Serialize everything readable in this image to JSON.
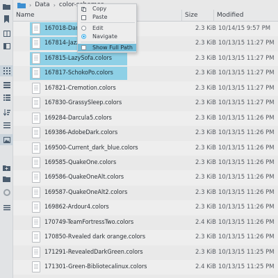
{
  "breadcrumb": [
    "Data",
    "color-schemes"
  ],
  "columns": {
    "name": "Name",
    "size": "Size",
    "modified": "Modified"
  },
  "context_menu": {
    "copy": "Copy",
    "paste": "Paste",
    "edit": "Edit",
    "navigate": "Navigate",
    "show_full_path": "Show Full Path"
  },
  "files": [
    {
      "name": "167018-Dar",
      "size": "2.3 KiB",
      "modified": "10/14/15 9:57 PM",
      "selected": true
    },
    {
      "name": "167814-Jazz",
      "size": "2.3 KiB",
      "modified": "10/13/15 11:27 PM",
      "selected": true
    },
    {
      "name": "167815-LazySofa.colors",
      "size": "2.3 KiB",
      "modified": "10/13/15 11:27 PM",
      "selected": true
    },
    {
      "name": "167817-SchokoPo.colors",
      "size": "2.3 KiB",
      "modified": "10/13/15 11:27 PM",
      "selected": true
    },
    {
      "name": "167821-Cremotion.colors",
      "size": "2.3 KiB",
      "modified": "10/13/15 11:27 PM",
      "selected": false
    },
    {
      "name": "167830-GrassySleep.colors",
      "size": "2.3 KiB",
      "modified": "10/13/15 11:27 PM",
      "selected": false
    },
    {
      "name": "169284-Darcula5.colors",
      "size": "2.3 KiB",
      "modified": "10/13/15 11:26 PM",
      "selected": false
    },
    {
      "name": "169386-AdobeDark.colors",
      "size": "2.3 KiB",
      "modified": "10/13/15 11:26 PM",
      "selected": false
    },
    {
      "name": "169500-Current_dark_blue.colors",
      "size": "2.3 KiB",
      "modified": "10/13/15 11:26 PM",
      "selected": false
    },
    {
      "name": "169585-QuakeOne.colors",
      "size": "2.3 KiB",
      "modified": "10/13/15 11:26 PM",
      "selected": false
    },
    {
      "name": "169586-QuakeOneAlt.colors",
      "size": "2.3 KiB",
      "modified": "10/13/15 11:26 PM",
      "selected": false
    },
    {
      "name": "169587-QuakeOneAlt2.colors",
      "size": "2.3 KiB",
      "modified": "10/13/15 11:26 PM",
      "selected": false
    },
    {
      "name": "169862-Ardour4.colors",
      "size": "2.3 KiB",
      "modified": "10/13/15 11:26 PM",
      "selected": false
    },
    {
      "name": "170749-TeamFortressTwo.colors",
      "size": "2.4 KiB",
      "modified": "10/13/15 11:26 PM",
      "selected": false
    },
    {
      "name": "170850-Rvealed dark orange.colors",
      "size": "2.3 KiB",
      "modified": "10/13/15 11:26 PM",
      "selected": false
    },
    {
      "name": "171291-RevealedDarkGreen.colors",
      "size": "2.3 KiB",
      "modified": "10/13/15 11:25 PM",
      "selected": false
    },
    {
      "name": "171301-Green-Bibliotecalinux.colors",
      "size": "2.4 KiB",
      "modified": "10/13/15 11:25 PM",
      "selected": false
    },
    {
      "name": "",
      "size": "",
      "modified": "",
      "selected": false
    }
  ],
  "sidebar_icons": [
    "folder-icon",
    "bookmark-icon",
    "list-icon",
    "panel-icon",
    "grid-icon",
    "list-icon",
    "details-icon",
    "tree-icon",
    "sort-icon",
    "image-icon",
    "new-folder-icon",
    "folder-icon",
    "refresh-icon",
    "menu-icon"
  ]
}
